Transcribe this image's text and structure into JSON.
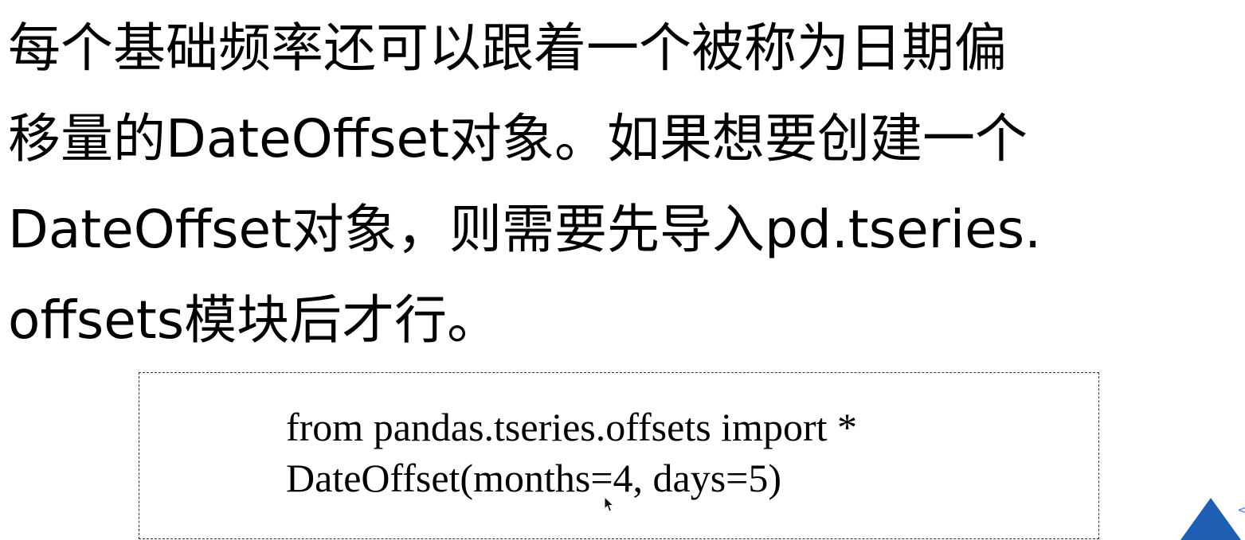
{
  "slide": {
    "paragraph_lines": [
      "每个基础频率还可以跟着一个被称为日期偏",
      "移量的DateOffset对象。如果想要创建一个",
      "DateOffset对象，则需要先导入pd.tseries.",
      "offsets模块后才行。"
    ],
    "code_lines": [
      "from pandas.tseries.offsets import *",
      "DateOffset(months=4, days=5)"
    ]
  },
  "icons": {
    "cursor": "mouse-pointer-icon",
    "nav": "triangle-nav-icon",
    "arrow": "chevron-left-icon",
    "arrow_glyph": "<"
  },
  "colors": {
    "nav_triangle": "#1f5fb3",
    "text": "#000000",
    "background": "#ffffff"
  }
}
